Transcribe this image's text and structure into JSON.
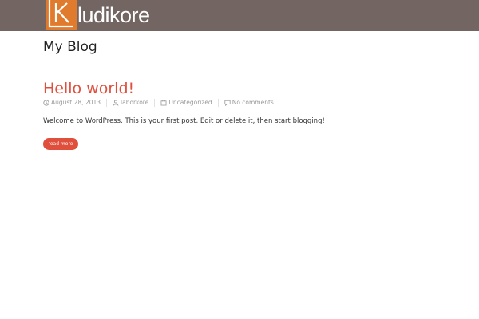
{
  "header": {
    "logo_text": "ludikore",
    "background_color": "#736662",
    "logo_mark_color": "#e07a2c"
  },
  "page": {
    "title": "My Blog"
  },
  "post": {
    "title": "Hello world!",
    "title_color": "#e04e3c",
    "meta": {
      "date": "August 28, 2013",
      "author": "laborkore",
      "category": "Uncategorized",
      "comments": "No comments"
    },
    "excerpt": "Welcome to WordPress. This is your first post. Edit or delete it, then start blogging!",
    "read_more_label": "read more"
  },
  "icons": {
    "date": "clock-icon",
    "author": "user-icon",
    "category": "folder-icon",
    "comments": "comment-icon"
  }
}
